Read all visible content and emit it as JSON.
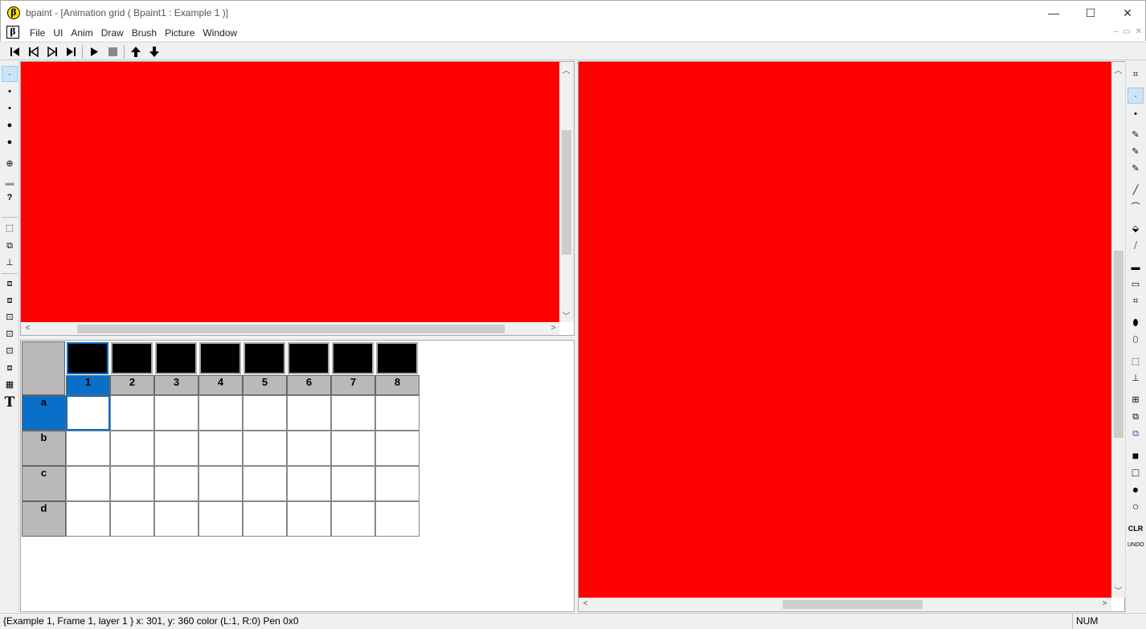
{
  "window": {
    "logo_letter": "β",
    "title": "bpaint - [Animation grid ( Bpaint1 : Example 1 )]",
    "minimize": "—",
    "maximize": "☐",
    "close": "✕"
  },
  "menu": {
    "items": [
      "File",
      "UI",
      "Anim",
      "Draw",
      "Brush",
      "Picture",
      "Window"
    ],
    "mdi_controls": [
      "–",
      "▭",
      "✕"
    ]
  },
  "anim_toolbar": {
    "buttons": [
      "first-frame-icon",
      "prev-frame-icon",
      "next-frame-icon",
      "last-frame-icon",
      "play-icon",
      "stop-icon",
      "up-arrow-icon",
      "down-arrow-icon"
    ]
  },
  "left_tools": [
    "·",
    "•",
    "•",
    "●",
    "●",
    "⊕",
    "▬",
    "?",
    "⬚",
    "⧉",
    "⊥",
    "⧈",
    "⧈",
    "⊡",
    "⊡",
    "⊡",
    "⧈",
    "▦",
    "T"
  ],
  "right_tools": [
    "⌗",
    "·",
    "•",
    "✎",
    "✎",
    "✎",
    "╱",
    "⌒",
    "⬙",
    "⧸",
    "▬",
    "▭",
    "⌗",
    "⬮",
    "⬯",
    "⬚",
    "⊥",
    "⊞",
    "⧉",
    "⧉",
    "■",
    "□",
    "●",
    "○",
    "CLR",
    "UNDO"
  ],
  "grid": {
    "frames": [
      "1",
      "2",
      "3",
      "4",
      "5",
      "6",
      "7",
      "8"
    ],
    "rows": [
      "a",
      "b",
      "c",
      "d"
    ],
    "active_frame": "1",
    "active_row": "a"
  },
  "colors": {
    "canvas": "#ff0000",
    "selection": "#0a6fc9"
  },
  "status": {
    "text": "{Example 1, Frame 1, layer 1 } x: 301, y: 360 color (L:1, R:0) Pen 0x0",
    "num": "NUM"
  }
}
